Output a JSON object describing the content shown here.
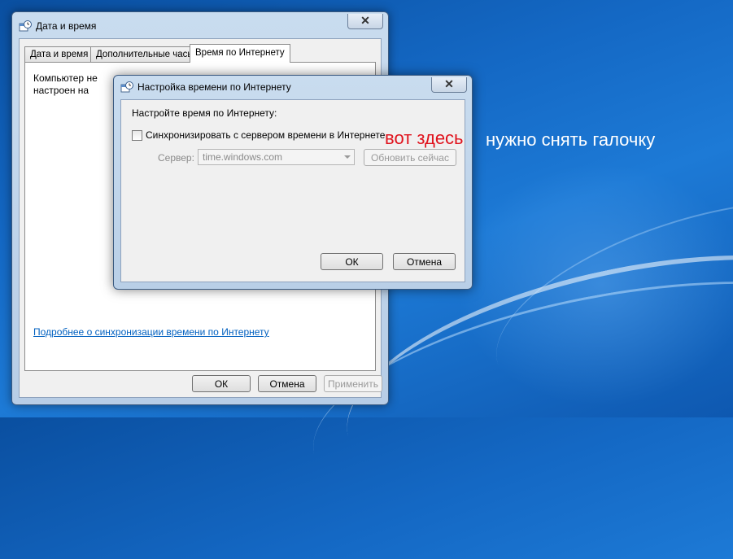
{
  "main_window": {
    "title": "Дата и время",
    "tabs": [
      "Дата и время",
      "Дополнительные часы",
      "Время по Интернету"
    ],
    "intro_text": "Компьютер не настроен на автоматическую синхронизацию с сервером времени.",
    "link_text": "Подробнее о синхронизации времени по Интернету",
    "buttons": {
      "ok": "ОК",
      "cancel": "Отмена",
      "apply": "Применить"
    },
    "close_glyph": "✕"
  },
  "dialog": {
    "title": "Настройка времени по Интернету",
    "heading": "Настройте время по Интернету:",
    "sync_checkbox_label": "Синхронизировать с сервером времени в Интернете",
    "sync_checked": false,
    "server_label": "Сервер:",
    "server_value": "time.windows.com",
    "update_button": "Обновить сейчас",
    "ok_button": "ОК",
    "cancel_button": "Отмена",
    "close_glyph": "✕"
  },
  "annotation": {
    "red_text": "вот здесь",
    "white_text": "нужно снять галочку",
    "red_color": "#e0141e"
  }
}
